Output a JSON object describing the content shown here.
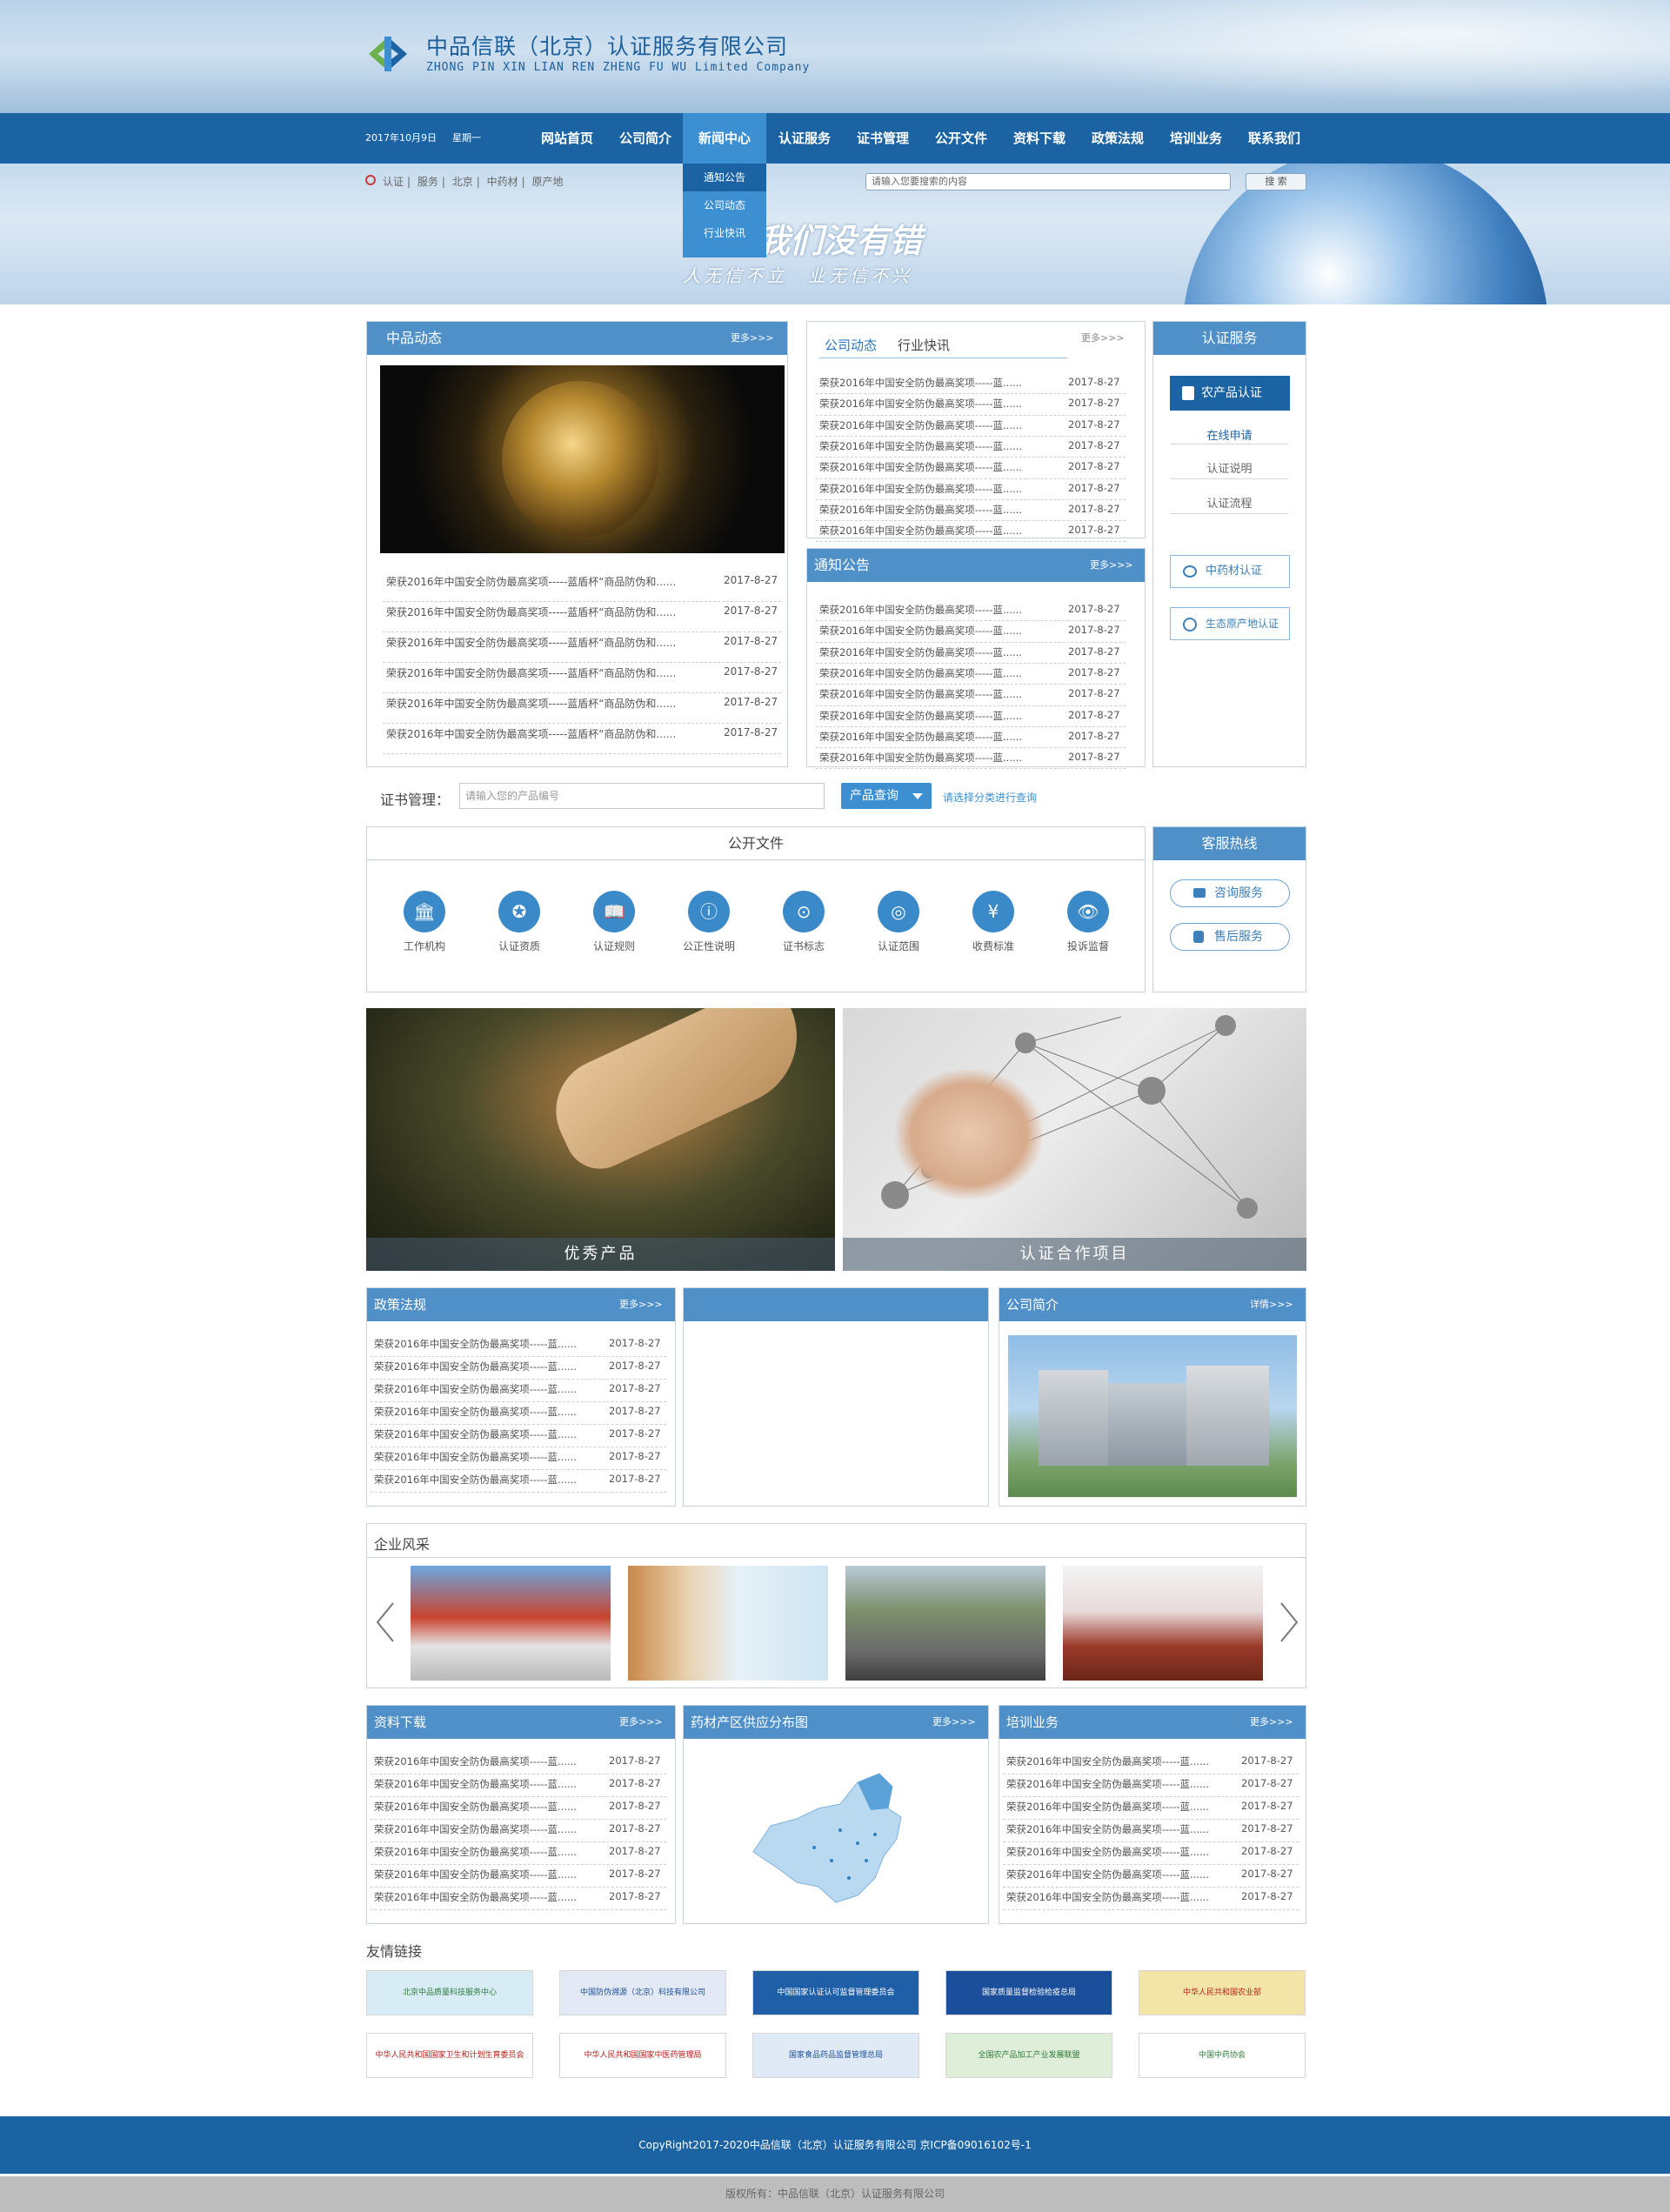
{
  "header": {
    "company_cn": "中品信联（北京）认证服务有限公司",
    "company_en": "ZHONG PIN XIN LIAN REN ZHENG FU WU Limited Company",
    "date": "2017年10月9日",
    "weekday": "星期一"
  },
  "nav": {
    "items": [
      "网站首页",
      "公司简介",
      "新闻中心",
      "认证服务",
      "证书管理",
      "公开文件",
      "资料下载",
      "政策法规",
      "培训业务",
      "联系我们"
    ],
    "active": "新闻中心",
    "submenu": [
      "通知公告",
      "公司动态",
      "行业快讯"
    ]
  },
  "tags": [
    "认证",
    "服务",
    "北京",
    "中药材",
    "原产地"
  ],
  "search": {
    "placeholder": "请输入您要搜索的内容",
    "button": "搜 索"
  },
  "banner": {
    "slogan_main": "我们没有错",
    "slogan_sub": "人无信不立　业无信不兴"
  },
  "news_item": "荣获2016年中国安全防伪最高奖项-----蓝盾杯“商品防伪和......",
  "news_item_short": "荣获2016年中国安全防伪最高奖项-----蓝......",
  "date_item": "2017-8-27",
  "more": "更多>>>",
  "more_detail": "详情>>>",
  "zp_news": {
    "title": "中品动态"
  },
  "news_tabs": {
    "tab1": "公司动态",
    "tab2": "行业快讯"
  },
  "notice": {
    "title": "通知公告"
  },
  "cert_service": {
    "title": "认证服务",
    "primary": "农产品认证",
    "links": [
      "在线申请",
      "认证说明",
      "认证流程"
    ],
    "buttons": [
      "中药材认证",
      "生态原产地认证"
    ]
  },
  "cert_mgmt": {
    "label": "证书管理：",
    "placeholder": "请输入您的产品编号",
    "button": "产品查询",
    "hint": "请选择分类进行查询"
  },
  "public_files": {
    "title": "公开文件",
    "items": [
      "工作机构",
      "认证资质",
      "认证规则",
      "公正性说明",
      "证书标志",
      "认证范围",
      "收费标准",
      "投诉监督"
    ]
  },
  "hotline": {
    "title": "客服热线",
    "buttons": [
      "咨询服务",
      "售后服务"
    ]
  },
  "showcase": {
    "left": "优秀产品",
    "right": "认证合作项目"
  },
  "policy": {
    "title": "政策法规"
  },
  "company": {
    "title": "公司简介"
  },
  "style": {
    "title": "企业风采"
  },
  "downloads": {
    "title": "资料下载"
  },
  "supply_map": {
    "title": "药材产区供应分布图"
  },
  "training": {
    "title": "培训业务"
  },
  "links": {
    "title": "友情链接",
    "items": [
      "北京中品质量科技服务中心",
      "中国防伪溯源（北京）科技有限公司",
      "中国国家认证认可监督管理委员会",
      "国家质量监督检验检疫总局",
      "中华人民共和国农业部",
      "中华人民共和国国家卫生和计划生育委员会",
      "中华人民共和国国家中医药管理局",
      "国家食品药品监督管理总局",
      "全国农产品加工产业发展联盟",
      "中国中药协会"
    ]
  },
  "footer": {
    "copyright": "CopyRight2017-2020中品信联（北京）认证服务有限公司 京ICP备09016102号-1",
    "owner": "版权所有：中品信联（北京）认证服务有限公司"
  },
  "colors": {
    "primary": "#1b63a3",
    "accent": "#4f90c8",
    "highlight": "#3c8fd1"
  },
  "icons": [
    "institution-icon",
    "qualification-icon",
    "rules-icon",
    "info-icon",
    "mark-icon",
    "scope-icon",
    "fee-icon",
    "eye-icon",
    "chat-icon",
    "phone-icon",
    "leaf-icon",
    "arrow-left-icon",
    "arrow-right-icon"
  ]
}
